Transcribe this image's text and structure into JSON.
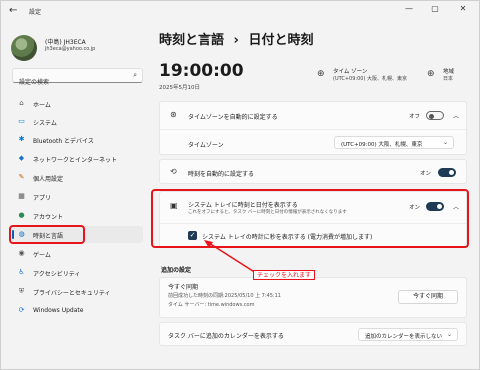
{
  "window": {
    "app_title": "設定",
    "back": "←",
    "minimize": "—",
    "maximize": "▢",
    "close": "✕"
  },
  "profile": {
    "name": "(中島) JH3ECA",
    "email": "jh3eca@yahoo.co.jp"
  },
  "search": {
    "placeholder": "設定の検索",
    "icon": "⌕"
  },
  "sidebar": {
    "items": [
      {
        "label": "ホーム",
        "icon": "home-icon",
        "glyph": "⌂"
      },
      {
        "label": "システム",
        "icon": "system-icon",
        "glyph": "▭"
      },
      {
        "label": "Bluetooth とデバイス",
        "icon": "bluetooth-icon",
        "glyph": "✱"
      },
      {
        "label": "ネットワークとインターネット",
        "icon": "network-icon",
        "glyph": "◆"
      },
      {
        "label": "個人用設定",
        "icon": "brush-icon",
        "glyph": "✎"
      },
      {
        "label": "アプリ",
        "icon": "apps-icon",
        "glyph": "▦"
      },
      {
        "label": "アカウント",
        "icon": "account-icon",
        "glyph": "●"
      },
      {
        "label": "時刻と言語",
        "icon": "globe-clock-icon",
        "glyph": "◍"
      },
      {
        "label": "ゲーム",
        "icon": "gamepad-icon",
        "glyph": "◉"
      },
      {
        "label": "アクセシビリティ",
        "icon": "accessibility-icon",
        "glyph": "♿"
      },
      {
        "label": "プライバシーとセキュリティ",
        "icon": "shield-icon",
        "glyph": "⛨"
      },
      {
        "label": "Windows Update",
        "icon": "update-icon",
        "glyph": "⟳"
      }
    ],
    "active_index": 7
  },
  "header": {
    "breadcrumb_parent": "時刻と言語",
    "separator": "›",
    "breadcrumb_current": "日付と時刻"
  },
  "clock": {
    "time": "19:00:00",
    "date": "2025年5月10日"
  },
  "timezone_info": {
    "label": "タイム ゾーン",
    "value": "(UTC+09:00) 大阪、札幌、東京"
  },
  "region_info": {
    "label": "地域",
    "value": "日本"
  },
  "settings": {
    "auto_timezone": {
      "label": "タイムゾーンを自動的に設定する",
      "state": "オフ"
    },
    "timezone": {
      "label": "タイムゾーン",
      "value": "(UTC+09:00) 大阪、札幌、東京"
    },
    "auto_time": {
      "label": "時刻を自動的に設定する",
      "state": "オン"
    },
    "tray": {
      "label": "システム トレイに時刻と日付を表示する",
      "description": "これをオフにすると、タスク バーに時刻と日付の情報が表示されなくなります",
      "state": "オン",
      "checkbox_label": "システム トレイの時計に秒を表示する (電力消費が増加します)",
      "checkbox_checked": true
    }
  },
  "additional": {
    "section_title": "追加の設定",
    "sync_title": "今すぐ同期",
    "sync_last": "前回成功した時刻の同期:2025/05/10 上 7:45:11",
    "sync_server": "タイム サーバー: time.windows.com",
    "sync_button": "今すぐ同期",
    "calendar_label": "タスク バーに追加のカレンダーを表示する",
    "calendar_value": "追加のカレンダーを表示しない"
  },
  "annotation": {
    "text": "チェックを入れます",
    "color": "#e8141b"
  },
  "colors": {
    "accent": "#005fb8",
    "toggle_on": "#1f3a55",
    "annotation": "#e8141b"
  }
}
